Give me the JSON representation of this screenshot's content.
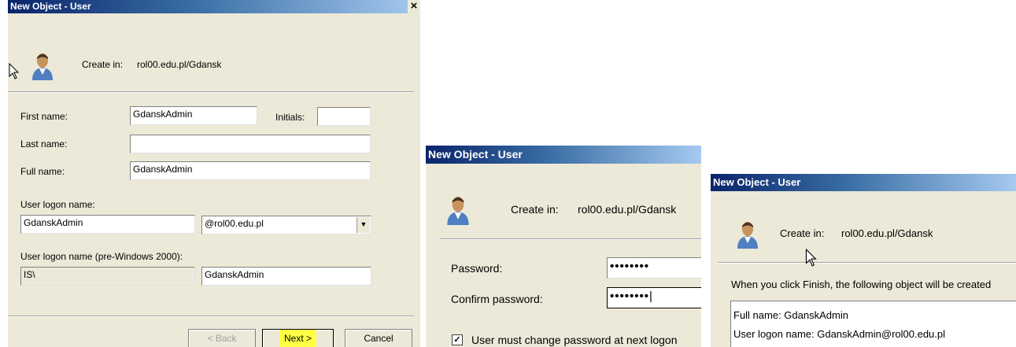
{
  "window1": {
    "title": "New Object - User",
    "close_glyph": "×",
    "create_in_label": "Create in:",
    "create_in_value": "rol00.edu.pl/Gdansk",
    "first_name_label": "First name:",
    "first_name_value": "GdanskAdmin",
    "initials_label": "Initials:",
    "initials_value": "",
    "last_name_label": "Last name:",
    "last_name_value": "",
    "full_name_label": "Full name:",
    "full_name_value": "GdanskAdmin",
    "logon_label": "User logon name:",
    "logon_value": "GdanskAdmin",
    "domain_value": "@rol00.edu.pl",
    "pre2000_label": "User logon name (pre-Windows 2000):",
    "pre2000_domain": "IS\\",
    "pre2000_value": "GdanskAdmin",
    "back_label": "< Back",
    "next_label": "Next >",
    "cancel_label": "Cancel"
  },
  "window2": {
    "title": "New Object - User",
    "create_in_label": "Create in:",
    "create_in_value": "rol00.edu.pl/Gdansk",
    "password_label": "Password:",
    "password_value": "••••••••",
    "confirm_label": "Confirm password:",
    "confirm_value": "••••••••",
    "must_change_label": "User must change password at next logon",
    "must_change_checked": "✓"
  },
  "window3": {
    "title": "New Object - User",
    "create_in_label": "Create in:",
    "create_in_value": "rol00.edu.pl/Gdansk",
    "summary_intro": "When you click Finish, the following object will be created",
    "summary_full_name": "Full name: GdanskAdmin",
    "summary_logon": "User logon name: GdanskAdmin@rol00.edu.pl"
  },
  "colors": {
    "title_bar_start": "#0a246a",
    "dialog_bg": "#ece9d8",
    "highlight": "#ffff44"
  }
}
